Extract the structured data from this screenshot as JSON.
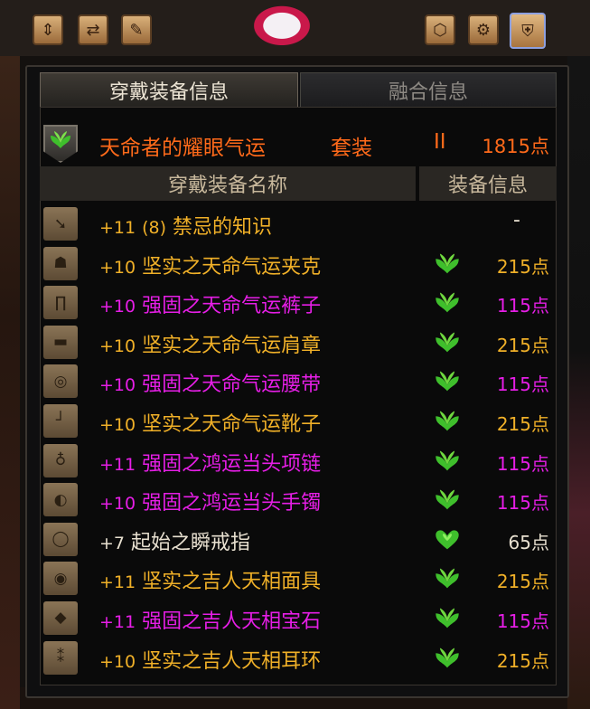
{
  "tabs": {
    "active": "穿戴装备信息",
    "inactive": "融合信息"
  },
  "set": {
    "name": "天命者的耀眼气运",
    "suffix": "套装",
    "level": "II",
    "points": "1815点",
    "color": "#ff6a1a"
  },
  "columns": {
    "name": "穿戴装备名称",
    "info": "装备信息"
  },
  "colors": {
    "gold": "#f0b028",
    "magenta": "#e61ee6",
    "leaf_green": "#3fbf2c"
  },
  "items": [
    {
      "slot_icon": "weapon-icon",
      "enhance": "+11",
      "extra": "(8)",
      "name": "禁忌的知识",
      "color": "gold",
      "set_icon": "",
      "points": "-"
    },
    {
      "slot_icon": "coat-icon",
      "enhance": "+10",
      "extra": "",
      "name": "坚实之天命气运夹克",
      "color": "gold",
      "set_icon": "leaf-emblem-icon",
      "points": "215点"
    },
    {
      "slot_icon": "pants-icon",
      "enhance": "+10",
      "extra": "",
      "name": "强固之天命气运裤子",
      "color": "magenta",
      "set_icon": "leaf-emblem-icon",
      "points": "115点"
    },
    {
      "slot_icon": "shoulder-icon",
      "enhance": "+10",
      "extra": "",
      "name": "坚实之天命气运肩章",
      "color": "gold",
      "set_icon": "leaf-emblem-icon",
      "points": "215点"
    },
    {
      "slot_icon": "belt-icon",
      "enhance": "+10",
      "extra": "",
      "name": "强固之天命气运腰带",
      "color": "magenta",
      "set_icon": "leaf-emblem-icon",
      "points": "115点"
    },
    {
      "slot_icon": "shoes-icon",
      "enhance": "+10",
      "extra": "",
      "name": "坚实之天命气运靴子",
      "color": "gold",
      "set_icon": "leaf-emblem-icon",
      "points": "215点"
    },
    {
      "slot_icon": "necklace-icon",
      "enhance": "+11",
      "extra": "",
      "name": "强固之鸿运当头项链",
      "color": "magenta",
      "set_icon": "leaf-emblem-icon",
      "points": "115点"
    },
    {
      "slot_icon": "bracelet-icon",
      "enhance": "+10",
      "extra": "",
      "name": "强固之鸿运当头手镯",
      "color": "magenta",
      "set_icon": "leaf-emblem-icon",
      "points": "115点"
    },
    {
      "slot_icon": "ring-icon",
      "enhance": "+7",
      "extra": "",
      "name": "起始之瞬戒指",
      "color": "white",
      "set_icon": "heart-emblem-icon",
      "points": "65点"
    },
    {
      "slot_icon": "mask-icon",
      "enhance": "+11",
      "extra": "",
      "name": "坚实之吉人天相面具",
      "color": "gold",
      "set_icon": "leaf-emblem-icon",
      "points": "215点"
    },
    {
      "slot_icon": "gem-icon",
      "enhance": "+11",
      "extra": "",
      "name": "强固之吉人天相宝石",
      "color": "magenta",
      "set_icon": "leaf-emblem-icon",
      "points": "115点"
    },
    {
      "slot_icon": "earring-icon",
      "enhance": "+10",
      "extra": "",
      "name": "坚实之吉人天相耳环",
      "color": "gold",
      "set_icon": "leaf-emblem-icon",
      "points": "215点"
    }
  ]
}
